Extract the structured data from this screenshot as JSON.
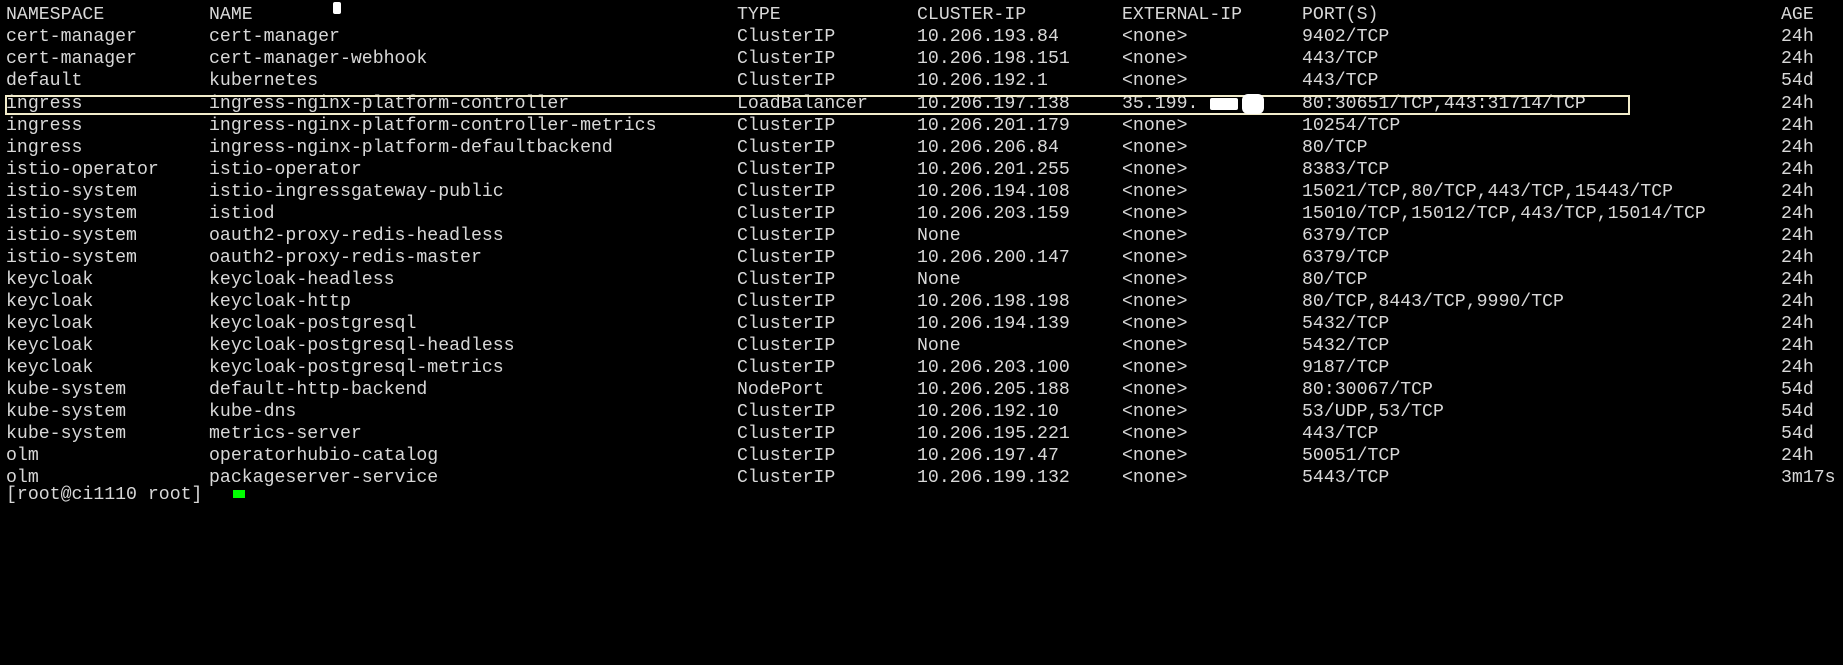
{
  "header": {
    "namespace": "NAMESPACE",
    "name": "NAME",
    "type": "TYPE",
    "cluster_ip": "CLUSTER-IP",
    "external_ip": "EXTERNAL-IP",
    "ports": "PORT(S)",
    "age": "AGE"
  },
  "rows": [
    {
      "namespace": "cert-manager",
      "name": "cert-manager",
      "type": "ClusterIP",
      "cluster_ip": "10.206.193.84",
      "external_ip": "<none>",
      "ports": "9402/TCP",
      "age": "24h"
    },
    {
      "namespace": "cert-manager",
      "name": "cert-manager-webhook",
      "type": "ClusterIP",
      "cluster_ip": "10.206.198.151",
      "external_ip": "<none>",
      "ports": "443/TCP",
      "age": "24h"
    },
    {
      "namespace": "default",
      "name": "kubernetes",
      "type": "ClusterIP",
      "cluster_ip": "10.206.192.1",
      "external_ip": "<none>",
      "ports": "443/TCP",
      "age": "54d"
    },
    {
      "namespace": "ingress",
      "name": "ingress-nginx-platform-controller",
      "type": "LoadBalancer",
      "cluster_ip": "10.206.197.138",
      "external_ip": "35.199.",
      "ports": "80:30651/TCP,443:31714/TCP",
      "age": "24h"
    },
    {
      "namespace": "ingress",
      "name": "ingress-nginx-platform-controller-metrics",
      "type": "ClusterIP",
      "cluster_ip": "10.206.201.179",
      "external_ip": "<none>",
      "ports": "10254/TCP",
      "age": "24h"
    },
    {
      "namespace": "ingress",
      "name": "ingress-nginx-platform-defaultbackend",
      "type": "ClusterIP",
      "cluster_ip": "10.206.206.84",
      "external_ip": "<none>",
      "ports": "80/TCP",
      "age": "24h"
    },
    {
      "namespace": "istio-operator",
      "name": "istio-operator",
      "type": "ClusterIP",
      "cluster_ip": "10.206.201.255",
      "external_ip": "<none>",
      "ports": "8383/TCP",
      "age": "24h"
    },
    {
      "namespace": "istio-system",
      "name": "istio-ingressgateway-public",
      "type": "ClusterIP",
      "cluster_ip": "10.206.194.108",
      "external_ip": "<none>",
      "ports": "15021/TCP,80/TCP,443/TCP,15443/TCP",
      "age": "24h"
    },
    {
      "namespace": "istio-system",
      "name": "istiod",
      "type": "ClusterIP",
      "cluster_ip": "10.206.203.159",
      "external_ip": "<none>",
      "ports": "15010/TCP,15012/TCP,443/TCP,15014/TCP",
      "age": "24h"
    },
    {
      "namespace": "istio-system",
      "name": "oauth2-proxy-redis-headless",
      "type": "ClusterIP",
      "cluster_ip": "None",
      "external_ip": "<none>",
      "ports": "6379/TCP",
      "age": "24h"
    },
    {
      "namespace": "istio-system",
      "name": "oauth2-proxy-redis-master",
      "type": "ClusterIP",
      "cluster_ip": "10.206.200.147",
      "external_ip": "<none>",
      "ports": "6379/TCP",
      "age": "24h"
    },
    {
      "namespace": "keycloak",
      "name": "keycloak-headless",
      "type": "ClusterIP",
      "cluster_ip": "None",
      "external_ip": "<none>",
      "ports": "80/TCP",
      "age": "24h"
    },
    {
      "namespace": "keycloak",
      "name": "keycloak-http",
      "type": "ClusterIP",
      "cluster_ip": "10.206.198.198",
      "external_ip": "<none>",
      "ports": "80/TCP,8443/TCP,9990/TCP",
      "age": "24h"
    },
    {
      "namespace": "keycloak",
      "name": "keycloak-postgresql",
      "type": "ClusterIP",
      "cluster_ip": "10.206.194.139",
      "external_ip": "<none>",
      "ports": "5432/TCP",
      "age": "24h"
    },
    {
      "namespace": "keycloak",
      "name": "keycloak-postgresql-headless",
      "type": "ClusterIP",
      "cluster_ip": "None",
      "external_ip": "<none>",
      "ports": "5432/TCP",
      "age": "24h"
    },
    {
      "namespace": "keycloak",
      "name": "keycloak-postgresql-metrics",
      "type": "ClusterIP",
      "cluster_ip": "10.206.203.100",
      "external_ip": "<none>",
      "ports": "9187/TCP",
      "age": "24h"
    },
    {
      "namespace": "kube-system",
      "name": "default-http-backend",
      "type": "NodePort",
      "cluster_ip": "10.206.205.188",
      "external_ip": "<none>",
      "ports": "80:30067/TCP",
      "age": "54d"
    },
    {
      "namespace": "kube-system",
      "name": "kube-dns",
      "type": "ClusterIP",
      "cluster_ip": "10.206.192.10",
      "external_ip": "<none>",
      "ports": "53/UDP,53/TCP",
      "age": "54d"
    },
    {
      "namespace": "kube-system",
      "name": "metrics-server",
      "type": "ClusterIP",
      "cluster_ip": "10.206.195.221",
      "external_ip": "<none>",
      "ports": "443/TCP",
      "age": "54d"
    },
    {
      "namespace": "olm",
      "name": "operatorhubio-catalog",
      "type": "ClusterIP",
      "cluster_ip": "10.206.197.47",
      "external_ip": "<none>",
      "ports": "50051/TCP",
      "age": "24h"
    },
    {
      "namespace": "olm",
      "name": "packageserver-service",
      "type": "ClusterIP",
      "cluster_ip": "10.206.199.132",
      "external_ip": "<none>",
      "ports": "5443/TCP",
      "age": "3m17s"
    }
  ],
  "prompt": "[root@ci1110 root]",
  "colors": {
    "background": "#000000",
    "text": "#d8d8d8",
    "highlight_border": "#f2eccb",
    "cursor": "#00ff00"
  }
}
